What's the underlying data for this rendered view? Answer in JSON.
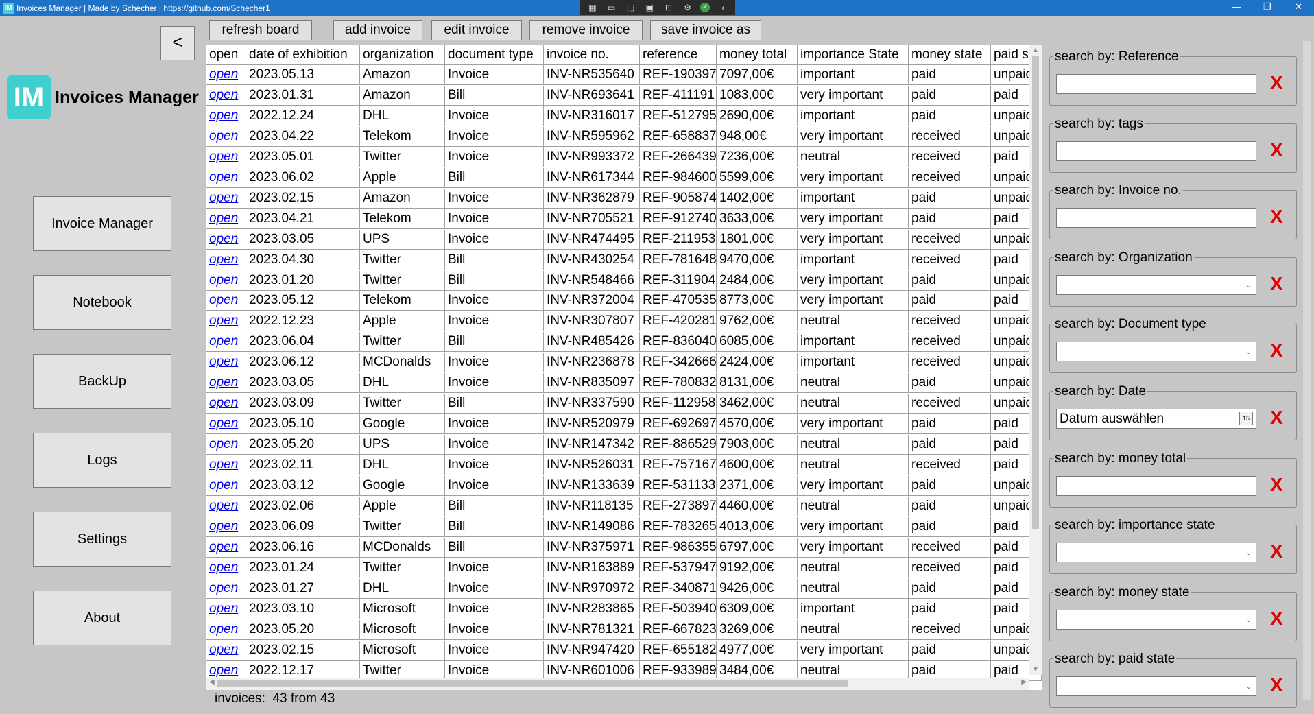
{
  "window": {
    "title": "Invoices Manager | Made by Schecher | https://github.com/Schecher1",
    "icon_text": "IM",
    "min_glyph": "—",
    "max_glyph": "❐",
    "close_glyph": "✕"
  },
  "sidebar": {
    "back_glyph": "<",
    "logo_text": "IM",
    "app_name": "Invoices Manager",
    "items": [
      {
        "label": "Invoice Manager"
      },
      {
        "label": "Notebook"
      },
      {
        "label": "BackUp"
      },
      {
        "label": "Logs"
      },
      {
        "label": "Settings"
      },
      {
        "label": "About"
      }
    ]
  },
  "toolbar": {
    "refresh": "refresh board",
    "add": "add invoice",
    "edit": "edit invoice",
    "remove": "remove invoice",
    "save_as": "save invoice as"
  },
  "grid": {
    "columns": [
      "open",
      "date of exhibition",
      "organization",
      "document type",
      "invoice no.",
      "reference",
      "money total",
      "importance State",
      "money state",
      "paid st"
    ],
    "rows": [
      [
        "open",
        "2023.05.13",
        "Amazon",
        "Invoice",
        "INV-NR535640",
        "REF-190397",
        "7097,00€",
        "important",
        "paid",
        "unpaid"
      ],
      [
        "open",
        "2023.01.31",
        "Amazon",
        "Bill",
        "INV-NR693641",
        "REF-411191",
        "1083,00€",
        "very important",
        "paid",
        "paid"
      ],
      [
        "open",
        "2022.12.24",
        "DHL",
        "Invoice",
        "INV-NR316017",
        "REF-512795",
        "2690,00€",
        "important",
        "paid",
        "unpaid"
      ],
      [
        "open",
        "2023.04.22",
        "Telekom",
        "Invoice",
        "INV-NR595962",
        "REF-658837",
        "948,00€",
        "very important",
        "received",
        "unpaid"
      ],
      [
        "open",
        "2023.05.01",
        "Twitter",
        "Invoice",
        "INV-NR993372",
        "REF-266439",
        "7236,00€",
        "neutral",
        "received",
        "paid"
      ],
      [
        "open",
        "2023.06.02",
        "Apple",
        "Bill",
        "INV-NR617344",
        "REF-984600",
        "5599,00€",
        "very important",
        "received",
        "unpaid"
      ],
      [
        "open",
        "2023.02.15",
        "Amazon",
        "Invoice",
        "INV-NR362879",
        "REF-905874",
        "1402,00€",
        "important",
        "paid",
        "unpaid"
      ],
      [
        "open",
        "2023.04.21",
        "Telekom",
        "Invoice",
        "INV-NR705521",
        "REF-912740",
        "3633,00€",
        "very important",
        "paid",
        "paid"
      ],
      [
        "open",
        "2023.03.05",
        "UPS",
        "Invoice",
        "INV-NR474495",
        "REF-211953",
        "1801,00€",
        "very important",
        "received",
        "unpaid"
      ],
      [
        "open",
        "2023.04.30",
        "Twitter",
        "Bill",
        "INV-NR430254",
        "REF-781648",
        "9470,00€",
        "important",
        "received",
        "paid"
      ],
      [
        "open",
        "2023.01.20",
        "Twitter",
        "Bill",
        "INV-NR548466",
        "REF-311904",
        "2484,00€",
        "very important",
        "paid",
        "unpaid"
      ],
      [
        "open",
        "2023.05.12",
        "Telekom",
        "Invoice",
        "INV-NR372004",
        "REF-470535",
        "8773,00€",
        "very important",
        "paid",
        "paid"
      ],
      [
        "open",
        "2022.12.23",
        "Apple",
        "Invoice",
        "INV-NR307807",
        "REF-420281",
        "9762,00€",
        "neutral",
        "received",
        "unpaid"
      ],
      [
        "open",
        "2023.06.04",
        "Twitter",
        "Bill",
        "INV-NR485426",
        "REF-836040",
        "6085,00€",
        "important",
        "received",
        "unpaid"
      ],
      [
        "open",
        "2023.06.12",
        "MCDonalds",
        "Invoice",
        "INV-NR236878",
        "REF-342666",
        "2424,00€",
        "important",
        "received",
        "unpaid"
      ],
      [
        "open",
        "2023.03.05",
        "DHL",
        "Invoice",
        "INV-NR835097",
        "REF-780832",
        "8131,00€",
        "neutral",
        "paid",
        "unpaid"
      ],
      [
        "open",
        "2023.03.09",
        "Twitter",
        "Bill",
        "INV-NR337590",
        "REF-112958",
        "3462,00€",
        "neutral",
        "received",
        "unpaid"
      ],
      [
        "open",
        "2023.05.10",
        "Google",
        "Invoice",
        "INV-NR520979",
        "REF-692697",
        "4570,00€",
        "very important",
        "paid",
        "paid"
      ],
      [
        "open",
        "2023.05.20",
        "UPS",
        "Invoice",
        "INV-NR147342",
        "REF-886529",
        "7903,00€",
        "neutral",
        "paid",
        "paid"
      ],
      [
        "open",
        "2023.02.11",
        "DHL",
        "Invoice",
        "INV-NR526031",
        "REF-757167",
        "4600,00€",
        "neutral",
        "received",
        "paid"
      ],
      [
        "open",
        "2023.03.12",
        "Google",
        "Invoice",
        "INV-NR133639",
        "REF-531133",
        "2371,00€",
        "very important",
        "paid",
        "unpaid"
      ],
      [
        "open",
        "2023.02.06",
        "Apple",
        "Bill",
        "INV-NR118135",
        "REF-273897",
        "4460,00€",
        "neutral",
        "paid",
        "unpaid"
      ],
      [
        "open",
        "2023.06.09",
        "Twitter",
        "Bill",
        "INV-NR149086",
        "REF-783265",
        "4013,00€",
        "very important",
        "paid",
        "paid"
      ],
      [
        "open",
        "2023.06.16",
        "MCDonalds",
        "Bill",
        "INV-NR375971",
        "REF-986355",
        "6797,00€",
        "very important",
        "received",
        "paid"
      ],
      [
        "open",
        "2023.01.24",
        "Twitter",
        "Invoice",
        "INV-NR163889",
        "REF-537947",
        "9192,00€",
        "neutral",
        "received",
        "paid"
      ],
      [
        "open",
        "2023.01.27",
        "DHL",
        "Invoice",
        "INV-NR970972",
        "REF-340871",
        "9426,00€",
        "neutral",
        "paid",
        "paid"
      ],
      [
        "open",
        "2023.03.10",
        "Microsoft",
        "Invoice",
        "INV-NR283865",
        "REF-503940",
        "6309,00€",
        "important",
        "paid",
        "paid"
      ],
      [
        "open",
        "2023.05.20",
        "Microsoft",
        "Invoice",
        "INV-NR781321",
        "REF-667823",
        "3269,00€",
        "neutral",
        "received",
        "unpaid"
      ],
      [
        "open",
        "2023.02.15",
        "Microsoft",
        "Invoice",
        "INV-NR947420",
        "REF-655182",
        "4977,00€",
        "very important",
        "paid",
        "unpaid"
      ],
      [
        "open",
        "2022.12.17",
        "Twitter",
        "Invoice",
        "INV-NR601006",
        "REF-933989",
        "3484,00€",
        "neutral",
        "paid",
        "paid"
      ]
    ]
  },
  "status": {
    "count_label": "invoices:  43 from 43"
  },
  "filters": [
    {
      "label": "search by: Reference",
      "kind": "text",
      "value": ""
    },
    {
      "label": "search by: tags",
      "kind": "text",
      "value": ""
    },
    {
      "label": "search by: Invoice no.",
      "kind": "text",
      "value": ""
    },
    {
      "label": "search by: Organization",
      "kind": "combo",
      "value": ""
    },
    {
      "label": "search by: Document type",
      "kind": "combo",
      "value": ""
    },
    {
      "label": "search by: Date",
      "kind": "date",
      "value": "Datum auswählen"
    },
    {
      "label": "search by: money total",
      "kind": "text",
      "value": ""
    },
    {
      "label": "search by: importance state",
      "kind": "combo",
      "value": ""
    },
    {
      "label": "search by: money state",
      "kind": "combo",
      "value": ""
    },
    {
      "label": "search by: paid state",
      "kind": "combo",
      "value": ""
    }
  ],
  "filter_clear_glyph": "X",
  "date_picker_glyph": "15",
  "colors": {
    "titlebar": "#1e73c8",
    "background": "#c6c6c6",
    "link": "#0000ee",
    "clear_x": "#e00000",
    "logo": "#3ecfcf"
  }
}
